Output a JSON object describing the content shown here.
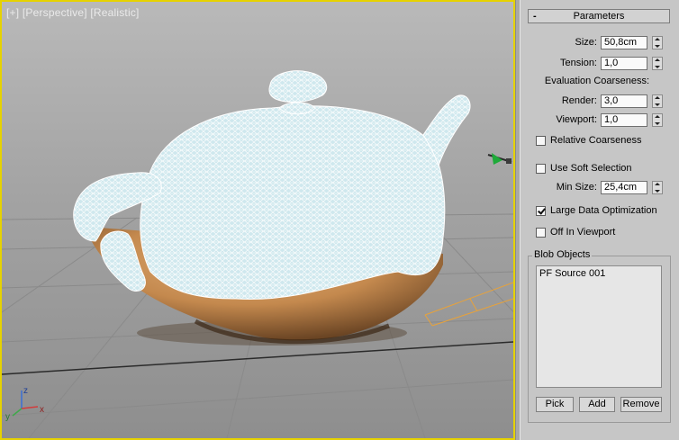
{
  "viewport": {
    "label_parts": [
      "[+]",
      "[Perspective]",
      "[Realistic]"
    ],
    "axis_labels": {
      "x": "x",
      "y": "y",
      "z": "z"
    }
  },
  "panel": {
    "rollout": {
      "collapse": "-",
      "title": "Parameters"
    },
    "size": {
      "label": "Size:",
      "value": "50,8cm"
    },
    "tension": {
      "label": "Tension:",
      "value": "1,0"
    },
    "evaluation_title": "Evaluation Coarseness:",
    "render": {
      "label": "Render:",
      "value": "3,0"
    },
    "viewport": {
      "label": "Viewport:",
      "value": "1,0"
    },
    "relative_coarseness": {
      "label": "Relative Coarseness",
      "checked": false
    },
    "use_soft_selection": {
      "label": "Use Soft Selection",
      "checked": false
    },
    "min_size": {
      "label": "Min Size:",
      "value": "25,4cm"
    },
    "large_data_optimization": {
      "label": "Large Data Optimization",
      "checked": true
    },
    "off_in_viewport": {
      "label": "Off In Viewport",
      "checked": false
    },
    "blob_objects": {
      "title": "Blob Objects",
      "items": [
        "PF Source 001"
      ],
      "buttons": {
        "pick": "Pick",
        "add": "Add",
        "remove": "Remove"
      }
    }
  },
  "colors": {
    "viewport_border": "#e6d200",
    "pot": "#c4894e",
    "mesh": "#cfe8ee",
    "wire": "#ffffff",
    "grid": "#8a8a8a",
    "grid_main": "#2b2b2b",
    "selection_box": "#e8a23a"
  },
  "icons": [
    "checkbox-icon",
    "spinner-up-icon",
    "spinner-down-icon",
    "axis-gizmo-icon",
    "light-gizmo-icon"
  ]
}
